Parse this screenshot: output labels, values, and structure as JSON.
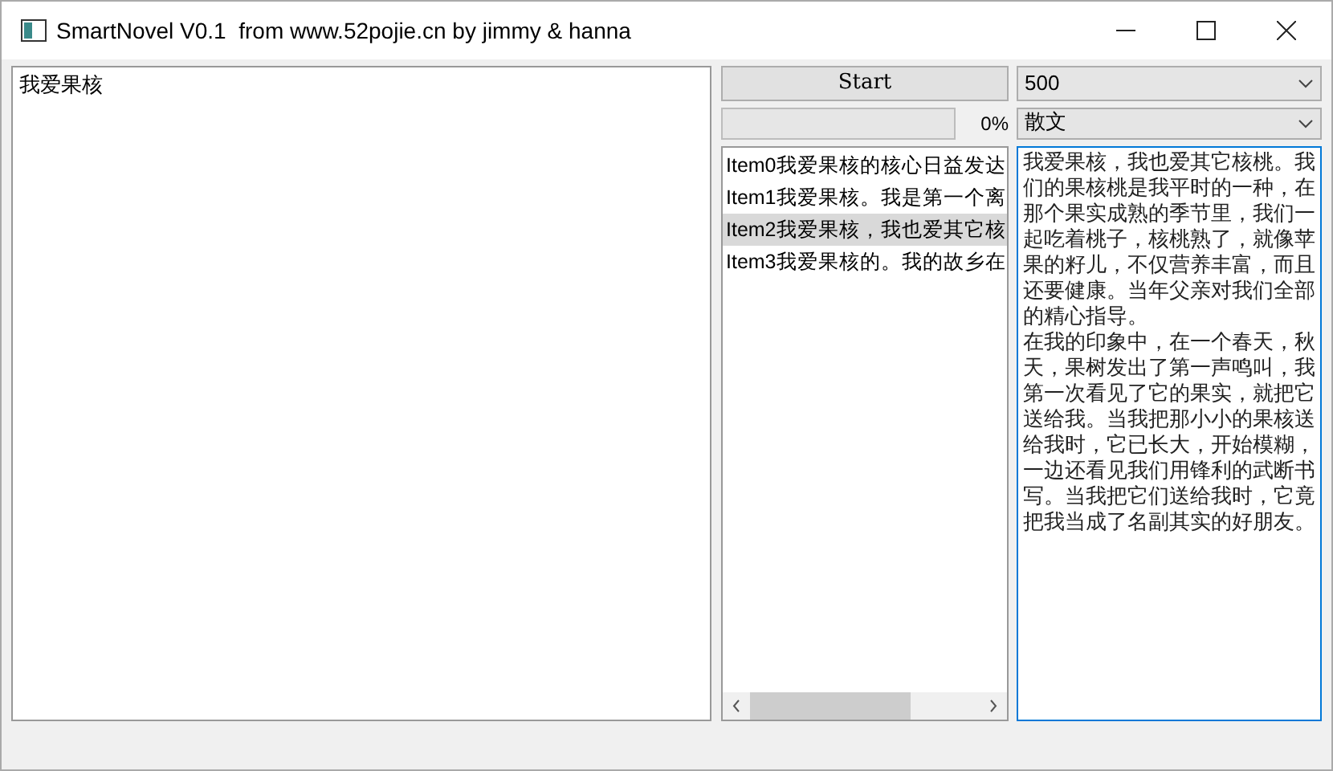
{
  "window": {
    "title": "SmartNovel V0.1  from www.52pojie.cn by jimmy & hanna"
  },
  "input_text": "我爱果核",
  "start_button": {
    "label": "Start"
  },
  "count_select": {
    "value": "500"
  },
  "progress": {
    "level": 0,
    "reading": "0%"
  },
  "style_select": {
    "value": "散文"
  },
  "items": [
    {
      "label": "Item0我爱果核的核心日益发达",
      "selected": false
    },
    {
      "label": "Item1我爱果核。我是第一个离",
      "selected": false
    },
    {
      "label": "Item2我爱果核，我也爱其它核",
      "selected": true
    },
    {
      "label": "Item3我爱果核的。我的故乡在",
      "selected": false
    }
  ],
  "output_text": [
    "我爱果核，我也爱其它核桃。我们的果核桃是我平时的一种，在那个果实成熟的季节里，我们一起吃着桃子，核桃熟了，就像苹果的籽儿，不仅营养丰富，而且还要健康。当年父亲对我们全部的精心指导。",
    "在我的印象中，在一个春天，秋天，果树发出了第一声鸣叫，我第一次看见了它的果实，就把它送给我。当我把那小小的果核送给我时，它已长大，开始模糊，一边还看见我们用锋利的武断书写。当我把它们送给我时，它竟把我当成了名副其实的好朋友。"
  ]
}
